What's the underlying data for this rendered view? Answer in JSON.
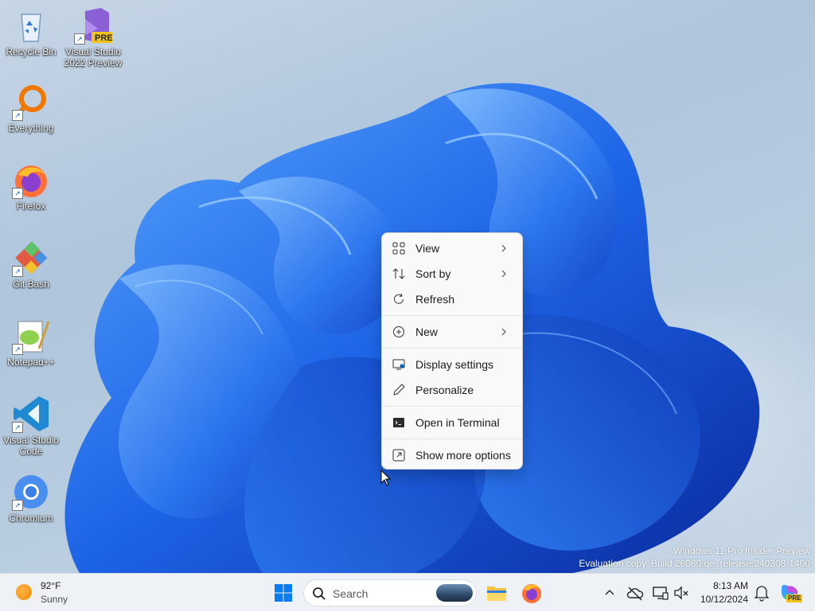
{
  "desktop": {
    "icons": [
      {
        "label": "Recycle Bin",
        "icon": "recycle-bin-icon"
      },
      {
        "label": "Visual Studio 2022 Preview",
        "badge": "PRE",
        "icon": "visual-studio-icon"
      },
      {
        "label": "Everything",
        "icon": "everything-search-icon"
      },
      {
        "label": "Firefox",
        "icon": "firefox-icon"
      },
      {
        "label": "Git Bash",
        "icon": "git-bash-icon"
      },
      {
        "label": "Notepad++",
        "icon": "notepadpp-icon"
      },
      {
        "label": "Visual Studio Code",
        "icon": "vscode-icon"
      },
      {
        "label": "Chromium",
        "icon": "chromium-icon"
      }
    ]
  },
  "context_menu": {
    "items": [
      {
        "label": "View",
        "icon": "view-grid-icon",
        "submenu": true
      },
      {
        "label": "Sort by",
        "icon": "sort-icon",
        "submenu": true
      },
      {
        "label": "Refresh",
        "icon": "refresh-icon",
        "submenu": false
      },
      {
        "label": "New",
        "icon": "new-plus-icon",
        "submenu": true
      },
      {
        "label": "Display settings",
        "icon": "display-icon",
        "submenu": false
      },
      {
        "label": "Personalize",
        "icon": "pen-icon",
        "submenu": false
      },
      {
        "label": "Open in Terminal",
        "icon": "terminal-icon",
        "submenu": false
      },
      {
        "label": "Show more options",
        "icon": "more-options-icon",
        "submenu": false
      }
    ]
  },
  "watermark": {
    "line1": "Windows 11 Pro Insider Preview",
    "line2": "Evaluation copy. Build 26080.ge_release.240308-1400"
  },
  "taskbar": {
    "weather": {
      "temp": "92°F",
      "condition": "Sunny"
    },
    "search_placeholder": "Search",
    "clock": {
      "time": "8:13 AM",
      "date": "10/12/2024"
    },
    "copilot_badge": "PRE"
  },
  "colors": {
    "accent": "#0067c0",
    "bloom_light": "#3d8cf0",
    "bloom_dark": "#0a2fa8"
  }
}
